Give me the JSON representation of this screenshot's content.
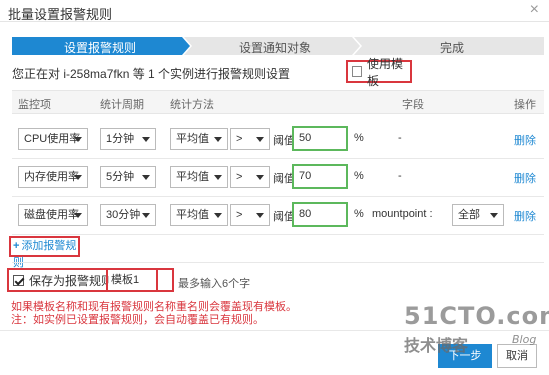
{
  "dialog": {
    "title": "批量设置报警规则",
    "close_glyph": "×"
  },
  "steps": [
    {
      "label": "设置报警规则",
      "active": true
    },
    {
      "label": "设置通知对象",
      "active": false
    },
    {
      "label": "完成",
      "active": false
    }
  ],
  "colors": {
    "active_step": "#1e88d2",
    "inactive_step": "#e6e6e6",
    "highlight": "#d9363e",
    "input_border": "#5cb85c",
    "link": "#1e88d2",
    "primary_button": "#1e88d2"
  },
  "info": {
    "text": "您正在对 i-258ma7fkn 等 1 个实例进行报警规则设置"
  },
  "use_template": {
    "label": "使用模板",
    "checked": false
  },
  "table": {
    "headers": {
      "metric": "监控项",
      "period": "统计周期",
      "method": "统计方法",
      "field": "字段",
      "action": "操作"
    },
    "rows": [
      {
        "metric": "CPU使用率",
        "period": "1分钟",
        "method": "平均值",
        "operator": ">",
        "threshold_label": "阈值",
        "threshold": "50",
        "unit": "%",
        "field": "-",
        "field_select": null,
        "delete": "删除"
      },
      {
        "metric": "内存使用率",
        "period": "5分钟",
        "method": "平均值",
        "operator": ">",
        "threshold_label": "阈值",
        "threshold": "70",
        "unit": "%",
        "field": "-",
        "field_select": null,
        "delete": "删除"
      },
      {
        "metric": "磁盘使用率",
        "period": "30分钟",
        "method": "平均值",
        "operator": ">",
        "threshold_label": "阈值",
        "threshold": "80",
        "unit": "%",
        "field": "mountpoint :",
        "field_select": "全部",
        "delete": "删除"
      }
    ]
  },
  "add_rule": {
    "icon": "+",
    "label": "添加报警规则"
  },
  "save_template": {
    "label": "保存为报警规则模板",
    "checked": true,
    "name_value": "模板1",
    "hint": "最多输入6个字"
  },
  "warnings": [
    "如果模板名称和现有报警规则名称重名则会覆盖现有模板。",
    "注：如实例已设置报警规则，会自动覆盖已有规则。"
  ],
  "footer": {
    "next_label": "下一步",
    "cancel_label": "取消"
  },
  "watermark": {
    "line1": "51CTO.com",
    "line2": "技术博客",
    "line3": "Blog"
  }
}
